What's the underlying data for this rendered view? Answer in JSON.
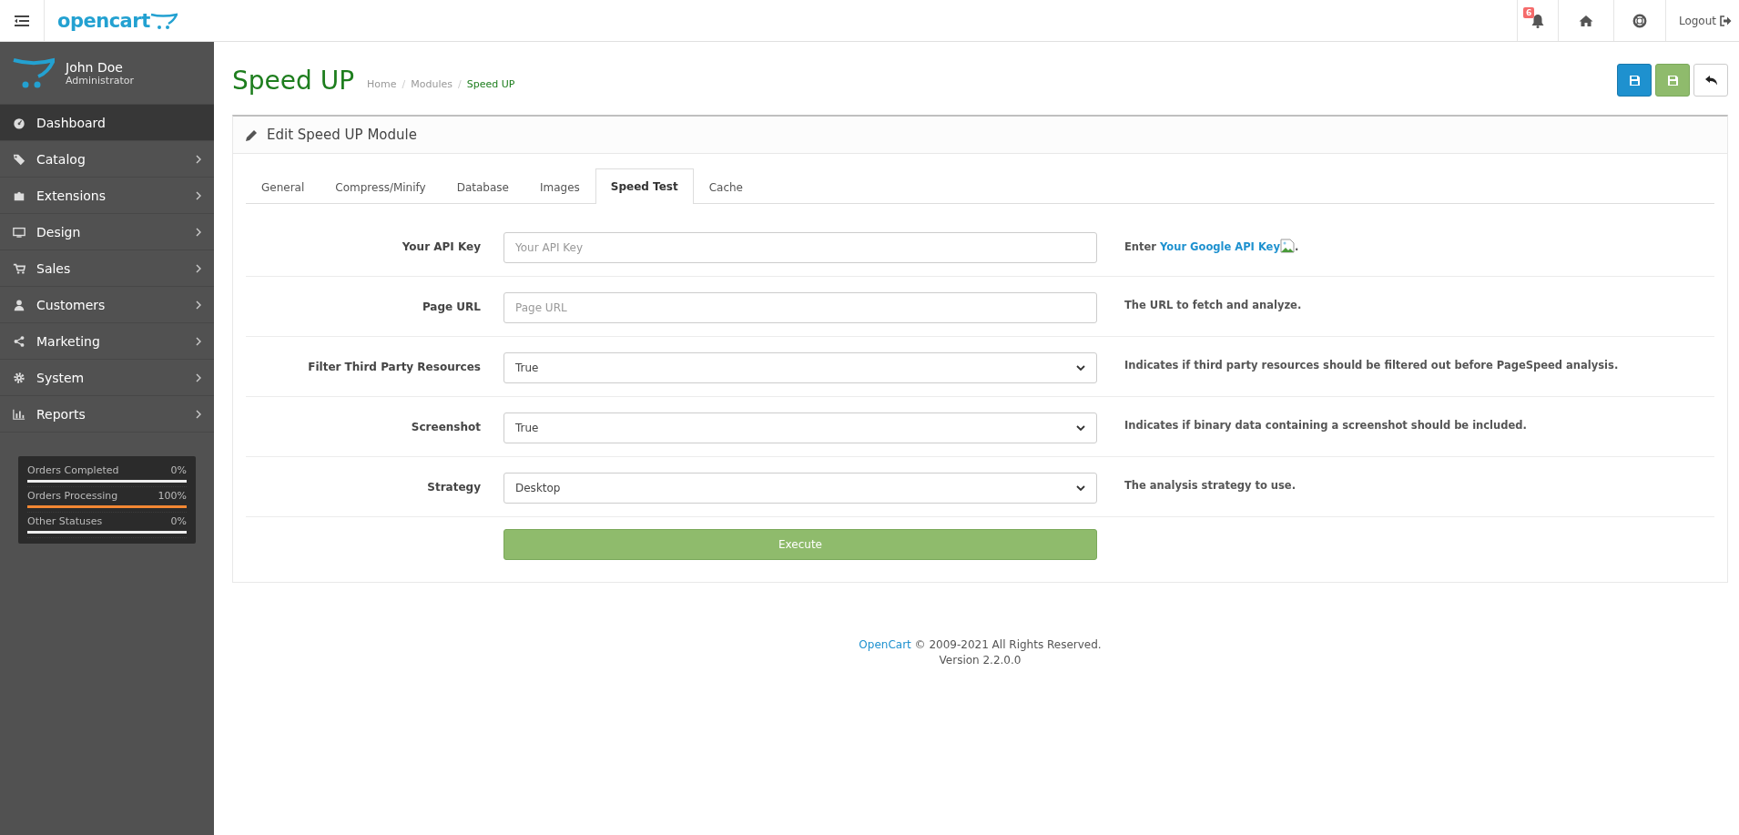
{
  "header": {
    "logo": "opencart",
    "notification_count": "6",
    "logout": "Logout"
  },
  "user": {
    "name": "John Doe",
    "role": "Administrator"
  },
  "menu": [
    {
      "label": "Dashboard",
      "selected": true,
      "has_children": false
    },
    {
      "label": "Catalog",
      "selected": false,
      "has_children": true
    },
    {
      "label": "Extensions",
      "selected": false,
      "has_children": true
    },
    {
      "label": "Design",
      "selected": false,
      "has_children": true
    },
    {
      "label": "Sales",
      "selected": false,
      "has_children": true
    },
    {
      "label": "Customers",
      "selected": false,
      "has_children": true
    },
    {
      "label": "Marketing",
      "selected": false,
      "has_children": true
    },
    {
      "label": "System",
      "selected": false,
      "has_children": true
    },
    {
      "label": "Reports",
      "selected": false,
      "has_children": true
    }
  ],
  "stats": [
    {
      "label": "Orders Completed",
      "reading": "0%",
      "level": 0
    },
    {
      "label": "Orders Processing",
      "reading": "100%",
      "level": 1
    },
    {
      "label": "Other Statuses",
      "reading": "0%",
      "level": 0
    }
  ],
  "page": {
    "title": "Speed UP",
    "breadcrumb": [
      "Home",
      "Modules",
      "Speed UP"
    ],
    "separator": "/"
  },
  "panel": {
    "title": "Edit Speed UP Module"
  },
  "tabs": [
    {
      "label": "General",
      "selected": false
    },
    {
      "label": "Compress/Minify",
      "selected": false
    },
    {
      "label": "Database",
      "selected": false
    },
    {
      "label": "Images",
      "selected": false
    },
    {
      "label": "Speed Test",
      "selected": true
    },
    {
      "label": "Cache",
      "selected": false
    }
  ],
  "fields": [
    {
      "kind": "input",
      "label": "Your API Key",
      "placeholder": "Your API Key",
      "help": {
        "prefix": "Enter ",
        "link": "Your Google API Key",
        "suffix": "."
      }
    },
    {
      "kind": "input",
      "label": "Page URL",
      "placeholder": "Page URL",
      "help": {
        "prefix": "The URL to fetch and analyze."
      }
    },
    {
      "kind": "select",
      "label": "Filter Third Party Resources",
      "value": "True",
      "help": {
        "prefix": "Indicates if third party resources should be filtered out before PageSpeed analysis."
      }
    },
    {
      "kind": "select",
      "label": "Screenshot",
      "value": "True",
      "help": {
        "prefix": "Indicates if binary data containing a screenshot should be included."
      }
    },
    {
      "kind": "select",
      "label": "Strategy",
      "value": "Desktop",
      "help": {
        "prefix": "The analysis strategy to use."
      }
    }
  ],
  "execute_button": "Execute",
  "footer": {
    "link": "OpenCart",
    "copyright": " © 2009-2021 All Rights Reserved.",
    "version": "Version 2.2.0.0"
  }
}
